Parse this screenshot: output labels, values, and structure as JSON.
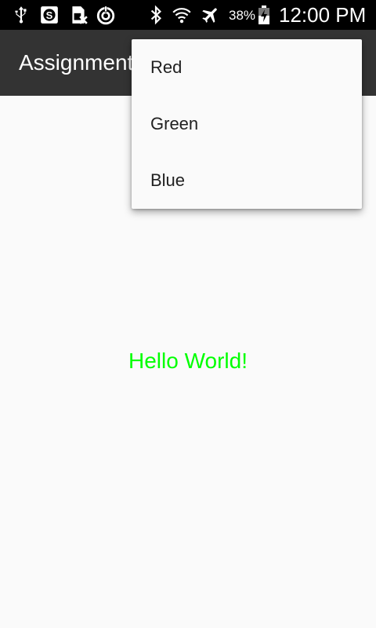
{
  "status_bar": {
    "icons": [
      "usb-icon",
      "sync-icon",
      "sim-error-icon",
      "data-saver-icon",
      "bluetooth-icon",
      "wifi-icon",
      "airplane-icon",
      "battery-icon"
    ],
    "battery_percent": "38%",
    "time": "12:00 PM",
    "background": "#000000"
  },
  "app_bar": {
    "title": "Assignment",
    "background": "#333333"
  },
  "content": {
    "hello_text": "Hello World!",
    "hello_color": "#00ff00"
  },
  "overflow_menu": {
    "items": [
      {
        "label": "Red"
      },
      {
        "label": "Green"
      },
      {
        "label": "Blue"
      }
    ]
  }
}
